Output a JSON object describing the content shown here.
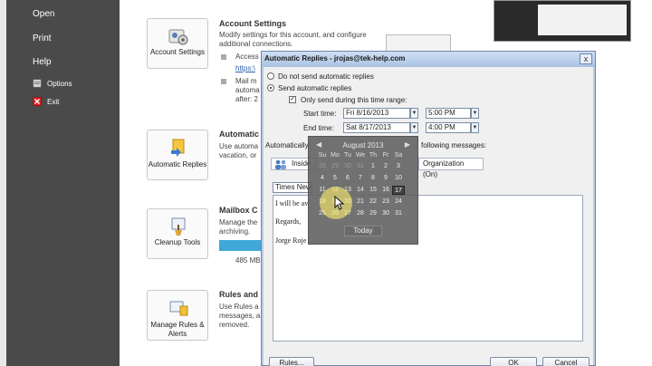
{
  "nav": {
    "items": [
      {
        "label": "Open"
      },
      {
        "label": "Print"
      },
      {
        "label": "Help"
      }
    ],
    "subitems": [
      {
        "label": "Options",
        "icon": "options-icon"
      },
      {
        "label": "Exit",
        "icon": "exit-icon"
      }
    ]
  },
  "account": {
    "card_label": "Account Settings",
    "title": "Account Settings",
    "desc": "Modify settings for this account, and configure additional connections.",
    "bullet1": "Access",
    "link": "https:\\",
    "bullet2_lines": [
      "Mail m",
      "automa",
      "after: 2"
    ]
  },
  "auto_replies": {
    "card_label": "Automatic Replies",
    "title": "Automatic",
    "desc": "Use automa vacation, or"
  },
  "cleanup": {
    "card_label": "Cleanup Tools",
    "title": "Mailbox C",
    "desc": "Manage the archiving.",
    "size": "485 MB"
  },
  "rules": {
    "card_label": "Manage Rules & Alerts",
    "title": "Rules and",
    "desc": "Use Rules a messages, a removed."
  },
  "dialog": {
    "title": "Automatic Replies - jrojas@tek-help.com",
    "close": "x",
    "opt_off": "Do not send automatic replies",
    "opt_on": "Send automatic replies",
    "range_check": "Only send during this time range:",
    "start_label": "Start time:",
    "start_date": "Fri 8/16/2013",
    "start_time": "5:00 PM",
    "end_label": "End time:",
    "end_date": "Sat 8/17/2013",
    "end_time": "4:00 PM",
    "auto_label": "Automatically",
    "following": "following messages:",
    "tab_inside": "Inside",
    "tab_outside": "Organization (On)",
    "font": "Times New",
    "body_lines": [
      "I will be av",
      "Regards,",
      "Jorge Roje"
    ],
    "rules_btn": "Rules...",
    "ok_btn": "OK",
    "cancel_btn": "Cancel"
  },
  "calendar": {
    "month": "August 2013",
    "dow": [
      "Su",
      "Mo",
      "Tu",
      "We",
      "Th",
      "Fr",
      "Sa"
    ],
    "weeks": [
      [
        "28",
        "29",
        "30",
        "31",
        "1",
        "2",
        "3"
      ],
      [
        "4",
        "5",
        "6",
        "7",
        "8",
        "9",
        "10"
      ],
      [
        "11",
        "12",
        "13",
        "14",
        "15",
        "16",
        "17"
      ],
      [
        "18",
        "19",
        "20",
        "21",
        "22",
        "23",
        "24"
      ],
      [
        "25",
        "26",
        "27",
        "28",
        "29",
        "30",
        "31"
      ]
    ],
    "today": "Today"
  }
}
